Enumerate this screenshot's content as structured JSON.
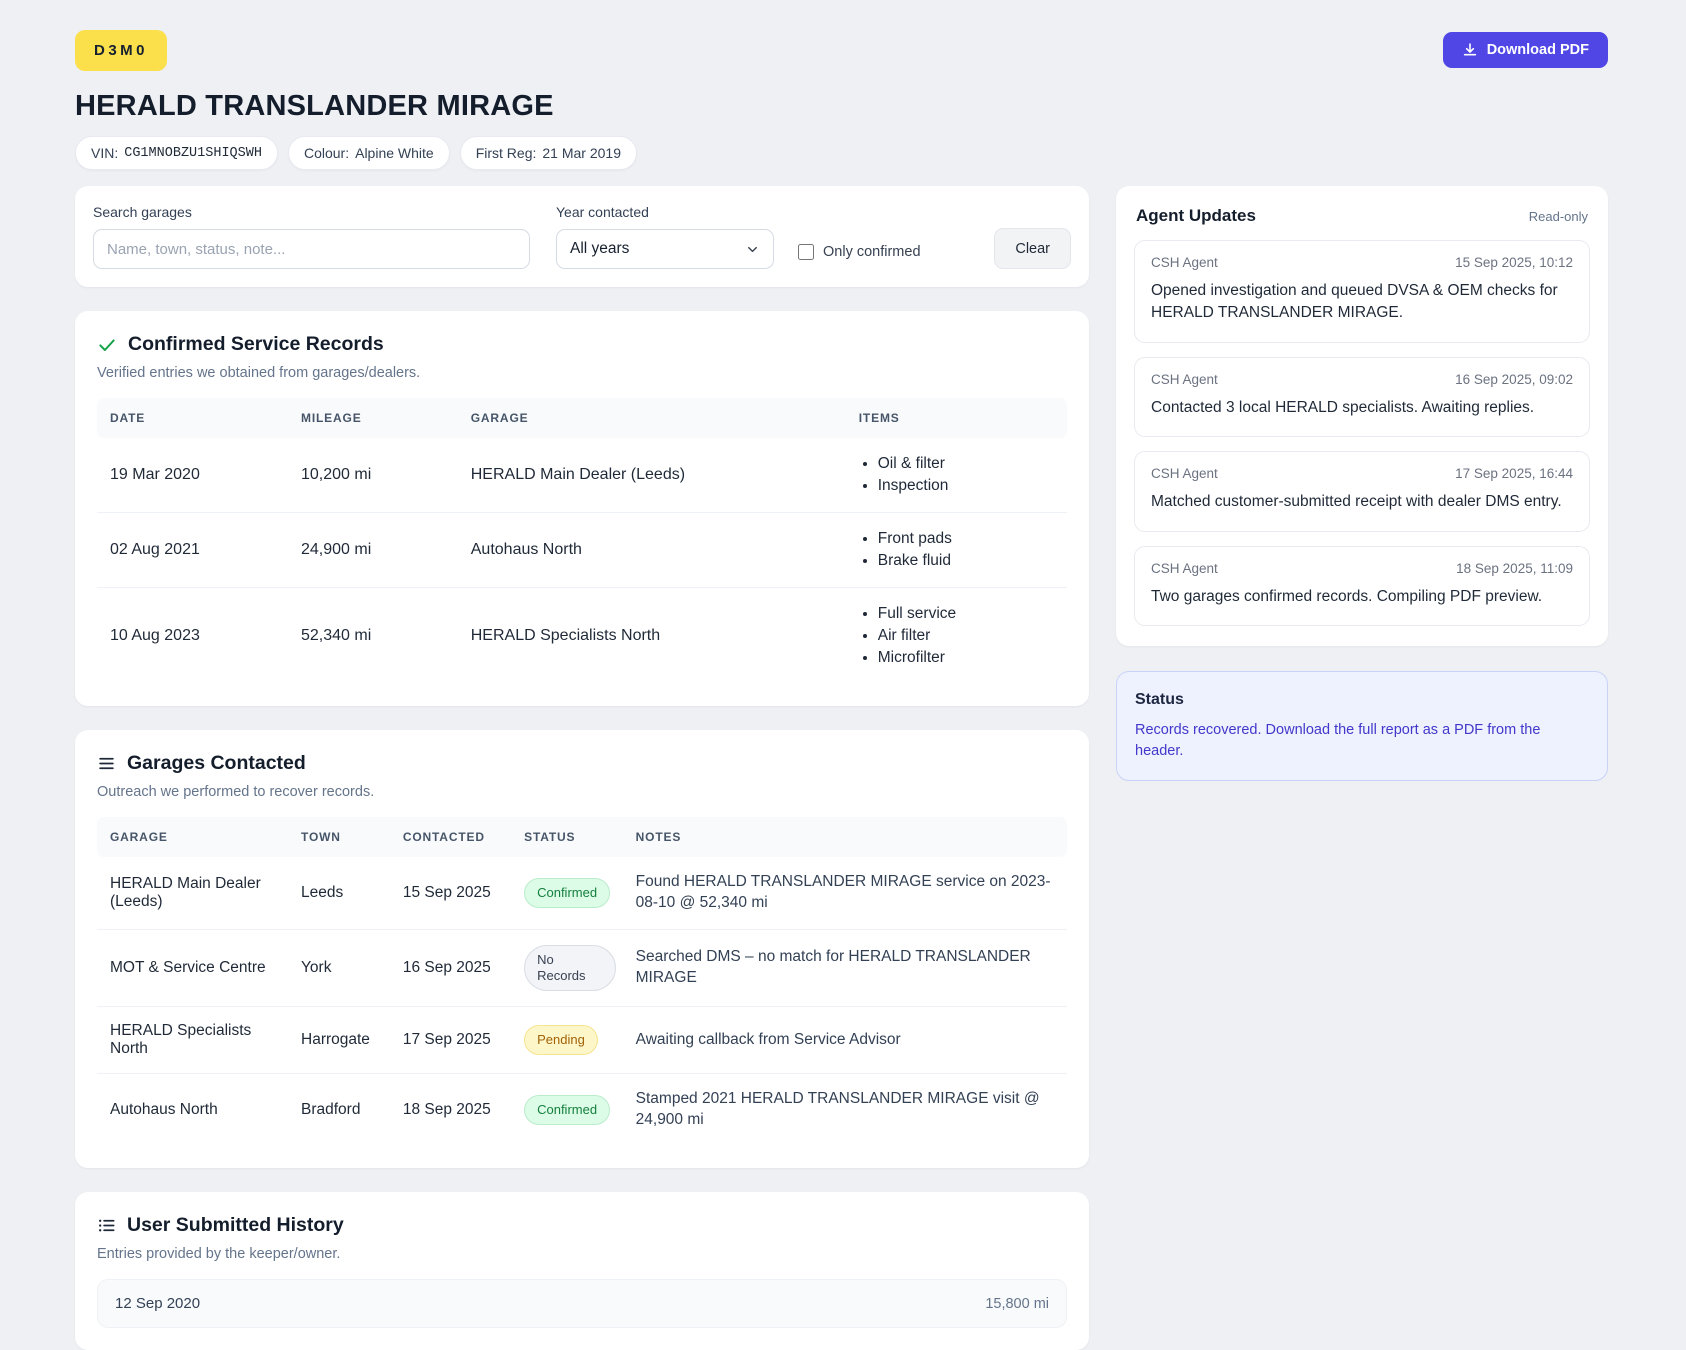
{
  "header": {
    "badge": "D3M0",
    "title": "HERALD TRANSLANDER MIRAGE",
    "chips": [
      {
        "label": "VIN:",
        "value": "CG1MNOBZU1SHIQSWH"
      },
      {
        "label": "Colour:",
        "value": "Alpine White"
      },
      {
        "label": "First Reg:",
        "value": "21 Mar 2019"
      }
    ],
    "download_button": "Download PDF"
  },
  "filters": {
    "search_label": "Search garages",
    "search_placeholder": "Name, town, status, note...",
    "year_label": "Year contacted",
    "year_value": "All years",
    "only_confirmed_label": "Only confirmed",
    "clear_label": "Clear"
  },
  "confirmed_records": {
    "title": "Confirmed Service Records",
    "subtitle": "Verified entries we obtained from garages/dealers.",
    "columns": [
      "Date",
      "Mileage",
      "Garage",
      "Items"
    ],
    "rows": [
      {
        "date": "19 Mar 2020",
        "mileage": "10,200 mi",
        "garage": "HERALD Main Dealer (Leeds)",
        "items": [
          "Oil & filter",
          "Inspection"
        ]
      },
      {
        "date": "02 Aug 2021",
        "mileage": "24,900 mi",
        "garage": "Autohaus North",
        "items": [
          "Front pads",
          "Brake fluid"
        ]
      },
      {
        "date": "10 Aug 2023",
        "mileage": "52,340 mi",
        "garage": "HERALD Specialists North",
        "items": [
          "Full service",
          "Air filter",
          "Microfilter"
        ]
      }
    ]
  },
  "garages_contacted": {
    "title": "Garages Contacted",
    "subtitle": "Outreach we performed to recover records.",
    "columns": [
      "Garage",
      "Town",
      "Contacted",
      "Status",
      "Notes"
    ],
    "rows": [
      {
        "garage": "HERALD Main Dealer (Leeds)",
        "town": "Leeds",
        "contacted": "15 Sep 2025",
        "status": "Confirmed",
        "status_kind": "confirmed",
        "notes": "Found HERALD TRANSLANDER MIRAGE service on 2023-08-10 @ 52,340 mi"
      },
      {
        "garage": "MOT & Service Centre",
        "town": "York",
        "contacted": "16 Sep 2025",
        "status": "No Records",
        "status_kind": "none",
        "notes": "Searched DMS – no match for HERALD TRANSLANDER MIRAGE"
      },
      {
        "garage": "HERALD Specialists North",
        "town": "Harrogate",
        "contacted": "17 Sep 2025",
        "status": "Pending",
        "status_kind": "pending",
        "notes": "Awaiting callback from Service Advisor"
      },
      {
        "garage": "Autohaus North",
        "town": "Bradford",
        "contacted": "18 Sep 2025",
        "status": "Confirmed",
        "status_kind": "confirmed",
        "notes": "Stamped 2021 HERALD TRANSLANDER MIRAGE visit @ 24,900 mi"
      }
    ]
  },
  "user_history": {
    "title": "User Submitted History",
    "subtitle": "Entries provided by the keeper/owner.",
    "rows": [
      {
        "date": "12 Sep 2020",
        "mileage": "15,800 mi"
      }
    ]
  },
  "agent_updates": {
    "title": "Agent Updates",
    "readonly_label": "Read-only",
    "messages": [
      {
        "author": "CSH Agent",
        "time": "15 Sep 2025, 10:12",
        "text": "Opened investigation and queued DVSA & OEM checks for HERALD TRANSLANDER MIRAGE."
      },
      {
        "author": "CSH Agent",
        "time": "16 Sep 2025, 09:02",
        "text": "Contacted 3 local HERALD specialists. Awaiting replies."
      },
      {
        "author": "CSH Agent",
        "time": "17 Sep 2025, 16:44",
        "text": "Matched customer-submitted receipt with dealer DMS entry."
      },
      {
        "author": "CSH Agent",
        "time": "18 Sep 2025, 11:09",
        "text": "Two garages confirmed records. Compiling PDF preview."
      }
    ]
  },
  "status_panel": {
    "title": "Status",
    "text": "Records recovered. Download the full report as a PDF from the header."
  },
  "colors": {
    "accent": "#4f46e5",
    "badge_yellow": "#fbdf4b",
    "confirmed_green": "#15803d",
    "pending_amber": "#a16207",
    "status_bg": "#eef1fe",
    "status_text": "#4338ca"
  }
}
